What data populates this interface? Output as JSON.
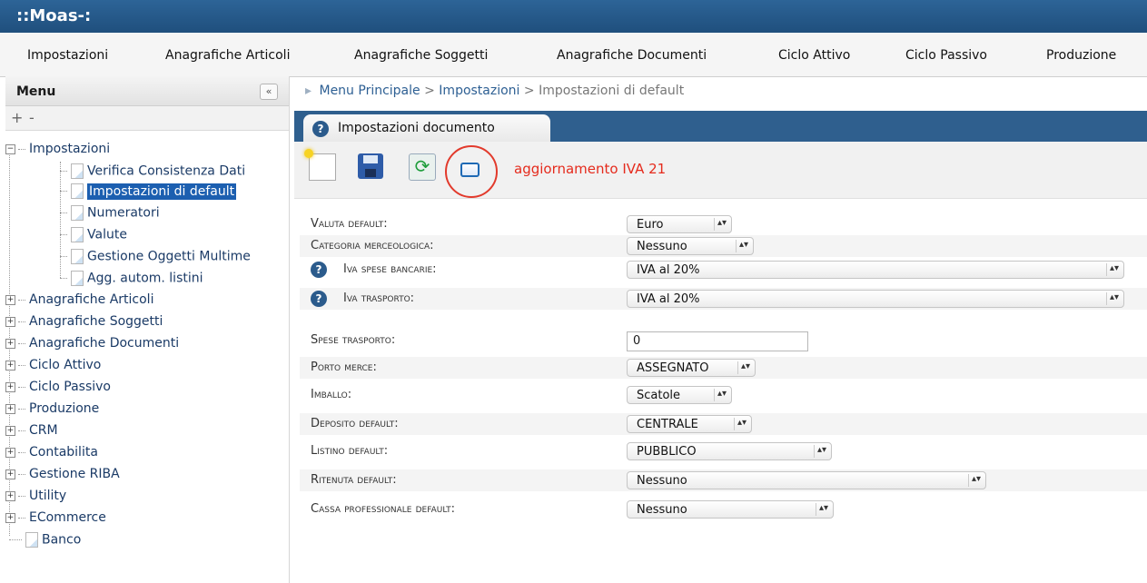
{
  "app": {
    "title": "::Moas-:"
  },
  "menubar": [
    "Impostazioni",
    "Anagrafiche Articoli",
    "Anagrafiche Soggetti",
    "Anagrafiche Documenti",
    "Ciclo Attivo",
    "Ciclo Passivo",
    "Produzione"
  ],
  "sidebar": {
    "title": "Menu",
    "collapse_label": "«",
    "expand_all": "+",
    "collapse_all": "-",
    "tree": {
      "impostazioni": "Impostazioni",
      "children": [
        "Verifica Consistenza Dati",
        "Impostazioni di default",
        "Numeratori",
        "Valute",
        "Gestione Oggetti Multime",
        "Agg. autom. listini"
      ],
      "groups": [
        "Anagrafiche Articoli",
        "Anagrafiche Soggetti",
        "Anagrafiche Documenti",
        "Ciclo Attivo",
        "Ciclo Passivo",
        "Produzione",
        "CRM",
        "Contabilita",
        "Gestione RIBA",
        "Utility",
        "ECommerce"
      ],
      "banco": "Banco"
    }
  },
  "breadcrumb": {
    "arrow": "▸",
    "root": "Menu Principale",
    "sep": ">",
    "section": "Impostazioni",
    "current": "Impostazioni di default"
  },
  "tab": {
    "help": "?",
    "label": "Impostazioni documento"
  },
  "toolbar": {
    "refresh_glyph": "⟳",
    "notice": "aggiornamento IVA 21"
  },
  "form": {
    "help": "?",
    "valuta": {
      "label": "Valuta default:",
      "value": "Euro"
    },
    "categoria": {
      "label": "Categoria merceologica:",
      "value": "Nessuno"
    },
    "iva_spese": {
      "label": "Iva spese bancarie:",
      "value": "IVA al 20%"
    },
    "iva_trasporto": {
      "label": "Iva trasporto:",
      "value": "IVA al 20%"
    },
    "spese_trasporto": {
      "label": "Spese trasporto:",
      "value": "0"
    },
    "porto": {
      "label": "Porto merce:",
      "value": "ASSEGNATO"
    },
    "imballo": {
      "label": "Imballo:",
      "value": "Scatole"
    },
    "deposito": {
      "label": "Deposito default:",
      "value": "CENTRALE"
    },
    "listino": {
      "label": "Listino default:",
      "value": "PUBBLICO"
    },
    "ritenuta": {
      "label": "Ritenuta default:",
      "value": "Nessuno"
    },
    "cassa": {
      "label": "Cassa professionale default:",
      "value": "Nessuno"
    }
  },
  "select_arrow": "▴▾"
}
